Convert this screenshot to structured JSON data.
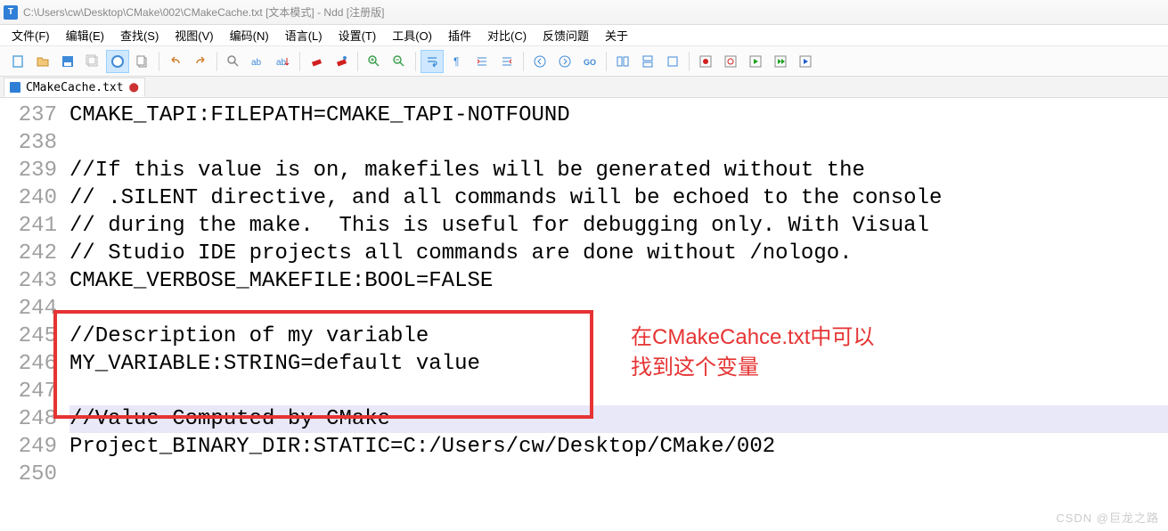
{
  "titlebar": {
    "icon_letter": "T",
    "text": "C:\\Users\\cw\\Desktop\\CMake\\002\\CMakeCache.txt [文本模式] - Ndd [注册版]"
  },
  "menu": [
    "文件(F)",
    "编辑(E)",
    "查找(S)",
    "视图(V)",
    "编码(N)",
    "语言(L)",
    "设置(T)",
    "工具(O)",
    "插件",
    "对比(C)",
    "反馈问题",
    "关于"
  ],
  "tab": {
    "label": "CMakeCache.txt"
  },
  "first_line_number": 237,
  "line_count": 14,
  "code_lines": [
    "CMAKE_TAPI:FILEPATH=CMAKE_TAPI-NOTFOUND",
    "",
    "//If this value is on, makefiles will be generated without the",
    "// .SILENT directive, and all commands will be echoed to the console",
    "// during the make.  This is useful for debugging only. With Visual",
    "// Studio IDE projects all commands are done without /nologo.",
    "CMAKE_VERBOSE_MAKEFILE:BOOL=FALSE",
    "",
    "//Description of my variable",
    "MY_VARIABLE:STRING=default value",
    "",
    "//Value Computed by CMake",
    "Project_BINARY_DIR:STATIC=C:/Users/cw/Desktop/CMake/002",
    ""
  ],
  "highlighted_line_index": 11,
  "annotation": {
    "line1": "在CMakeCahce.txt中可以",
    "line2": "找到这个变量"
  },
  "watermark": "CSDN @巨龙之路",
  "icons": {
    "new": "#5aa7e0",
    "open": "#e0a34c",
    "save": "#3f8ad8",
    "saveall": "#bbb",
    "circle_blue": "#3f8ad8",
    "circle_red": "#d05050",
    "rec": "#d02020",
    "play": "#20a020",
    "stop": "#2060d0"
  }
}
